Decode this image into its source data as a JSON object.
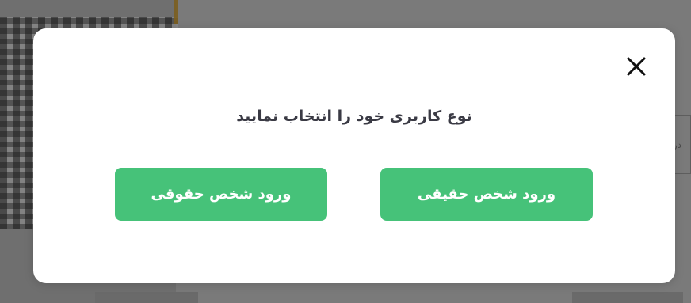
{
  "dialog": {
    "title": "نوع کاربری خود را انتخاب نمایید",
    "buttons": {
      "legal_person": "ورود شخص حقوقی",
      "real_person": "ورود شخص حقیقی"
    },
    "close_icon": "close-icon"
  },
  "background": {
    "partial_label": "در"
  },
  "colors": {
    "primary_button": "#46c279",
    "dialog_bg": "#ffffff",
    "overlay": "#6f6f6f"
  }
}
